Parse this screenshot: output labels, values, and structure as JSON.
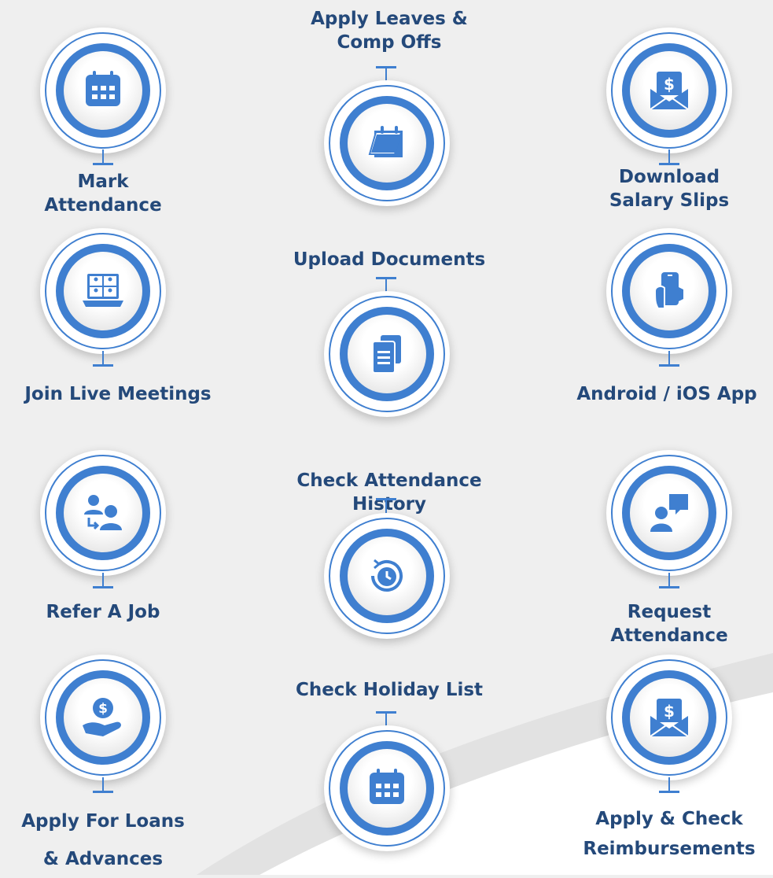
{
  "accent_color": "#3f7fd0",
  "label_color": "#24497a",
  "features": {
    "mark_attendance": {
      "label": "Mark\nAttendance",
      "icon": "calendar-icon"
    },
    "apply_leaves": {
      "label": "Apply Leaves &\nComp Offs",
      "icon": "leave-calendar-icon"
    },
    "download_salary": {
      "label": "Download\nSalary Slips",
      "icon": "salary-envelope-icon"
    },
    "join_meetings": {
      "label": "Join Live Meetings",
      "icon": "video-meeting-icon"
    },
    "upload_documents": {
      "label": "Upload Documents",
      "icon": "documents-icon"
    },
    "mobile_app": {
      "label": "Android / iOS App",
      "icon": "phone-hand-icon"
    },
    "refer_job": {
      "label": "Refer A Job",
      "icon": "refer-users-icon"
    },
    "attendance_history": {
      "label": "Check Attendance History",
      "icon": "clock-history-icon"
    },
    "request_attendance": {
      "label": "Request\nAttendance",
      "icon": "user-chat-icon"
    },
    "apply_loans": {
      "label": "Apply For Loans\n& Advances",
      "icon": "dollar-hand-icon"
    },
    "holiday_list": {
      "label": "Check Holiday List",
      "icon": "calendar-icon"
    },
    "reimbursements": {
      "label": "Apply & Check\nReimbursements",
      "icon": "salary-envelope-icon"
    }
  }
}
